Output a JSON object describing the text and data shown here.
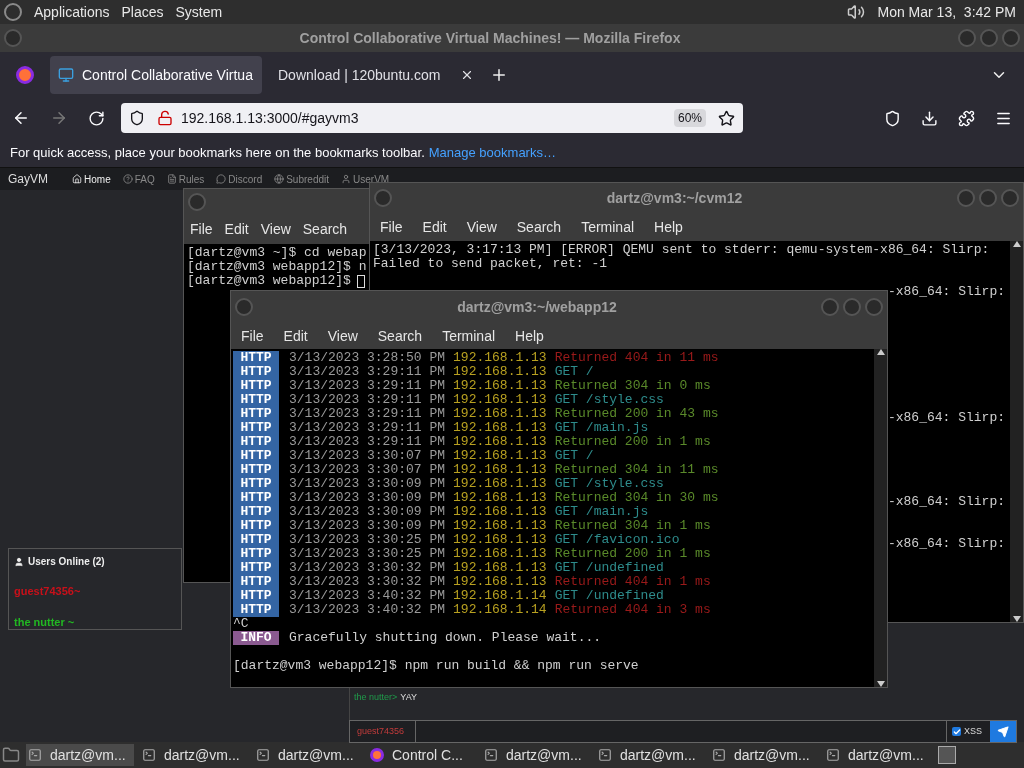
{
  "top_panel": {
    "menus": [
      "Applications",
      "Places",
      "System"
    ],
    "clock": "Mon Mar 13,  3:42 PM"
  },
  "browser": {
    "title": "Control Collaborative Virtual Machines! — Mozilla Firefox",
    "tabs": [
      {
        "label": "Control Collaborative Virtua",
        "selected": true
      },
      {
        "label": "Download | 120buntu.com",
        "selected": false
      }
    ],
    "url": "192.168.1.13:3000/#gayvm3",
    "zoom": "60%",
    "bookmarks_hint": "For quick access, place your bookmarks here on the bookmarks toolbar.",
    "bookmarks_link": "Manage bookmarks…"
  },
  "site_nav": {
    "brand": "GayVM",
    "links": [
      "Home",
      "FAQ",
      "Rules",
      "Discord",
      "Subreddit",
      "UserVM"
    ]
  },
  "back_terminal": {
    "menus": [
      "File",
      "Edit",
      "View",
      "Search"
    ],
    "lines": [
      "[dartz@vm3 ~]$ cd webap",
      "[dartz@vm3 webapp12]$ n",
      "[dartz@vm3 webapp12]$"
    ]
  },
  "cvm_terminal": {
    "title": "dartz@vm3:~/cvm12",
    "menus": [
      "File",
      "Edit",
      "View",
      "Search",
      "Terminal",
      "Help"
    ],
    "lines": [
      {
        "kind": "full",
        "text": "[3/13/2023, 3:17:13 PM] [ERROR] QEMU sent to stderr: qemu-system-x86_64: Slirp:"
      },
      {
        "kind": "full",
        "text": "Failed to send packet, ret: -1"
      },
      {
        "kind": "blank"
      },
      {
        "kind": "tail",
        "text": "-x86_64: Slirp:"
      },
      {
        "kind": "blank"
      },
      {
        "kind": "blank"
      },
      {
        "kind": "blank"
      },
      {
        "kind": "blank"
      },
      {
        "kind": "blank"
      },
      {
        "kind": "blank"
      },
      {
        "kind": "blank"
      },
      {
        "kind": "blank"
      },
      {
        "kind": "tail",
        "text": "-x86_64: Slirp:"
      },
      {
        "kind": "blank"
      },
      {
        "kind": "blank"
      },
      {
        "kind": "blank"
      },
      {
        "kind": "blank"
      },
      {
        "kind": "blank"
      },
      {
        "kind": "tail",
        "text": "-x86_64: Slirp:"
      },
      {
        "kind": "blank"
      },
      {
        "kind": "blank"
      },
      {
        "kind": "tail",
        "text": "-x86_64: Slirp:"
      }
    ]
  },
  "webapp_terminal": {
    "title": "dartz@vm3:~/webapp12",
    "menus": [
      "File",
      "Edit",
      "View",
      "Search",
      "Terminal",
      "Help"
    ],
    "log": [
      {
        "tag": "HTTP",
        "time": "3/13/2023 3:28:50 PM",
        "ip": "192.168.1.13",
        "message": "Returned 404 in 11 ms",
        "kind": "error"
      },
      {
        "tag": "HTTP",
        "time": "3/13/2023 3:29:11 PM",
        "ip": "192.168.1.13",
        "message": "GET /",
        "kind": "request"
      },
      {
        "tag": "HTTP",
        "time": "3/13/2023 3:29:11 PM",
        "ip": "192.168.1.13",
        "message": "Returned 304 in 0 ms",
        "kind": "ok"
      },
      {
        "tag": "HTTP",
        "time": "3/13/2023 3:29:11 PM",
        "ip": "192.168.1.13",
        "message": "GET /style.css",
        "kind": "request"
      },
      {
        "tag": "HTTP",
        "time": "3/13/2023 3:29:11 PM",
        "ip": "192.168.1.13",
        "message": "Returned 200 in 43 ms",
        "kind": "ok"
      },
      {
        "tag": "HTTP",
        "time": "3/13/2023 3:29:11 PM",
        "ip": "192.168.1.13",
        "message": "GET /main.js",
        "kind": "request"
      },
      {
        "tag": "HTTP",
        "time": "3/13/2023 3:29:11 PM",
        "ip": "192.168.1.13",
        "message": "Returned 200 in 1 ms",
        "kind": "ok"
      },
      {
        "tag": "HTTP",
        "time": "3/13/2023 3:30:07 PM",
        "ip": "192.168.1.13",
        "message": "GET /",
        "kind": "request"
      },
      {
        "tag": "HTTP",
        "time": "3/13/2023 3:30:07 PM",
        "ip": "192.168.1.13",
        "message": "Returned 304 in 11 ms",
        "kind": "ok"
      },
      {
        "tag": "HTTP",
        "time": "3/13/2023 3:30:09 PM",
        "ip": "192.168.1.13",
        "message": "GET /style.css",
        "kind": "request"
      },
      {
        "tag": "HTTP",
        "time": "3/13/2023 3:30:09 PM",
        "ip": "192.168.1.13",
        "message": "Returned 304 in 30 ms",
        "kind": "ok"
      },
      {
        "tag": "HTTP",
        "time": "3/13/2023 3:30:09 PM",
        "ip": "192.168.1.13",
        "message": "GET /main.js",
        "kind": "request"
      },
      {
        "tag": "HTTP",
        "time": "3/13/2023 3:30:09 PM",
        "ip": "192.168.1.13",
        "message": "Returned 304 in 1 ms",
        "kind": "ok"
      },
      {
        "tag": "HTTP",
        "time": "3/13/2023 3:30:25 PM",
        "ip": "192.168.1.13",
        "message": "GET /favicon.ico",
        "kind": "request"
      },
      {
        "tag": "HTTP",
        "time": "3/13/2023 3:30:25 PM",
        "ip": "192.168.1.13",
        "message": "Returned 200 in 1 ms",
        "kind": "ok"
      },
      {
        "tag": "HTTP",
        "time": "3/13/2023 3:30:32 PM",
        "ip": "192.168.1.13",
        "message": "GET /undefined",
        "kind": "request"
      },
      {
        "tag": "HTTP",
        "time": "3/13/2023 3:30:32 PM",
        "ip": "192.168.1.13",
        "message": "Returned 404 in 1 ms",
        "kind": "error"
      },
      {
        "tag": "HTTP",
        "time": "3/13/2023 3:40:32 PM",
        "ip": "192.168.1.14",
        "message": "GET /undefined",
        "kind": "request"
      },
      {
        "tag": "HTTP",
        "time": "3/13/2023 3:40:32 PM",
        "ip": "192.168.1.14",
        "message": "Returned 404 in 3 ms",
        "kind": "error"
      }
    ],
    "interrupt": "^C",
    "info_tag": "INFO",
    "info_text": "Gracefully shutting down. Please wait...",
    "prompt": "[dartz@vm3 webapp12]$ npm run build && npm run serve"
  },
  "users_online": {
    "title": "Users Online (2)",
    "users": [
      {
        "name": "guest74356~",
        "color": "#c8101a"
      },
      {
        "name": "the nutter ~",
        "color": "#22b822"
      }
    ]
  },
  "chat": {
    "messages": [
      {
        "user": "the nutter>",
        "text": "YAY"
      }
    ],
    "username": "guest74356",
    "xss": {
      "label": "XSS",
      "checked": true
    }
  },
  "taskbar": [
    {
      "kind": "terminal",
      "label": "dartz@vm...",
      "selected": true
    },
    {
      "kind": "terminal",
      "label": "dartz@vm...",
      "selected": false
    },
    {
      "kind": "terminal",
      "label": "dartz@vm...",
      "selected": false
    },
    {
      "kind": "firefox",
      "label": "Control C...",
      "selected": false
    },
    {
      "kind": "terminal",
      "label": "dartz@vm...",
      "selected": false
    },
    {
      "kind": "terminal",
      "label": "dartz@vm...",
      "selected": false
    },
    {
      "kind": "terminal",
      "label": "dartz@vm...",
      "selected": false
    },
    {
      "kind": "terminal",
      "label": "dartz@vm...",
      "selected": false
    }
  ]
}
